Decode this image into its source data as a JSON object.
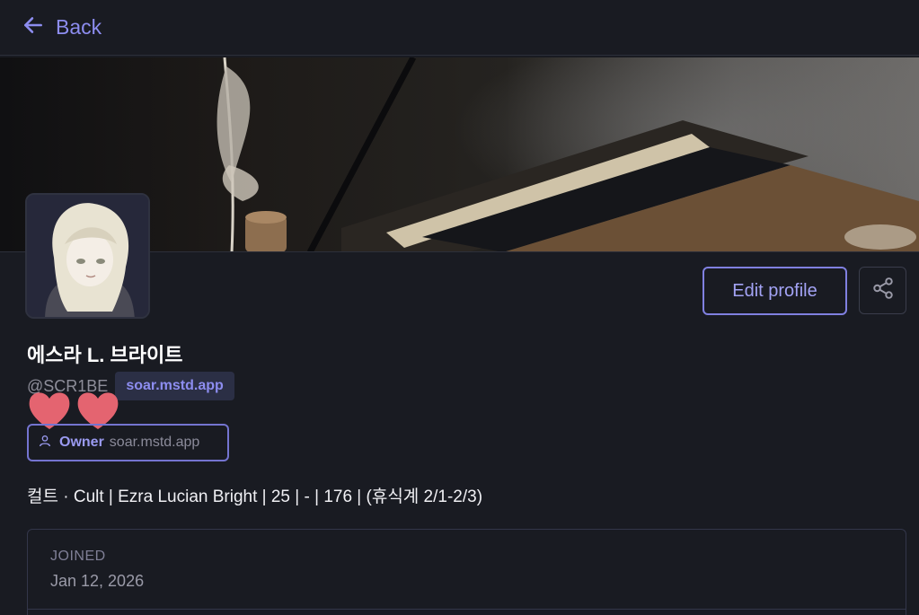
{
  "nav": {
    "back_label": "Back"
  },
  "profile": {
    "display_name": "에스라 L. 브라이트",
    "handle": "@SCR1BE",
    "domain_badge": "soar.mstd.app",
    "role_name": "Owner",
    "role_domain": "soar.mstd.app",
    "bio": "컬트 · Cult | Ezra Lucian Bright | 25 | - | 176 | (휴식계 2/1-2/3)",
    "edit_label": "Edit profile"
  },
  "fields": [
    {
      "label": "JOINED",
      "value": "Jan 12, 2026"
    }
  ],
  "colors": {
    "background": "#191b22",
    "accent": "#8d8df0",
    "border": "#33364a",
    "heart": "#e46470"
  }
}
